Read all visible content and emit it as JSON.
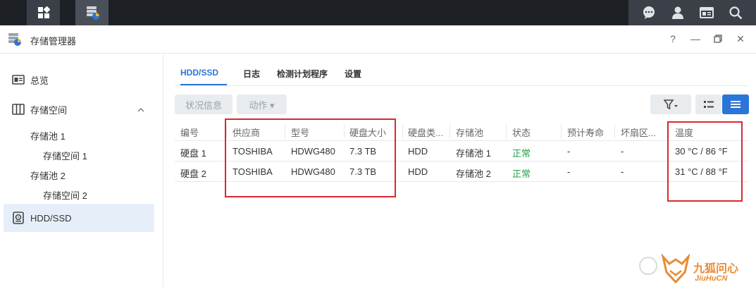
{
  "app": {
    "title": "存储管理器"
  },
  "window": {
    "help": "?",
    "minimize": "—",
    "close": "✕"
  },
  "sidebar": {
    "overview": "总览",
    "storage_space": "存储空间",
    "pool1": "存储池 1",
    "space1": "存储空间 1",
    "pool2": "存储池 2",
    "space2": "存储空间 2",
    "hdd": "HDD/SSD"
  },
  "tabs": [
    "HDD/SSD",
    "日志",
    "检测计划程序",
    "设置"
  ],
  "toolbar": {
    "status_info": "状况信息",
    "action": "动作 ▾"
  },
  "table": {
    "headers": [
      "编号",
      "供应商",
      "型号",
      "硬盘大小",
      "硬盘类...",
      "存储池",
      "状态",
      "预计寿命",
      "坏扇区...",
      "温度"
    ],
    "rows": [
      [
        "硬盘 1",
        "TOSHIBA",
        "HDWG480",
        "7.3 TB",
        "HDD",
        "存储池 1",
        "正常",
        "-",
        "-",
        "30 °C / 86 °F"
      ],
      [
        "硬盘 2",
        "TOSHIBA",
        "HDWG480",
        "7.3 TB",
        "HDD",
        "存储池 2",
        "正常",
        "-",
        "-",
        "31 °C / 88 °F"
      ]
    ]
  },
  "watermark": {
    "text": "九狐问心",
    "sub": "JiuHuCN"
  },
  "colors": {
    "accent": "#2a75d8",
    "ok": "#26a044",
    "highlight": "#d9292f"
  }
}
